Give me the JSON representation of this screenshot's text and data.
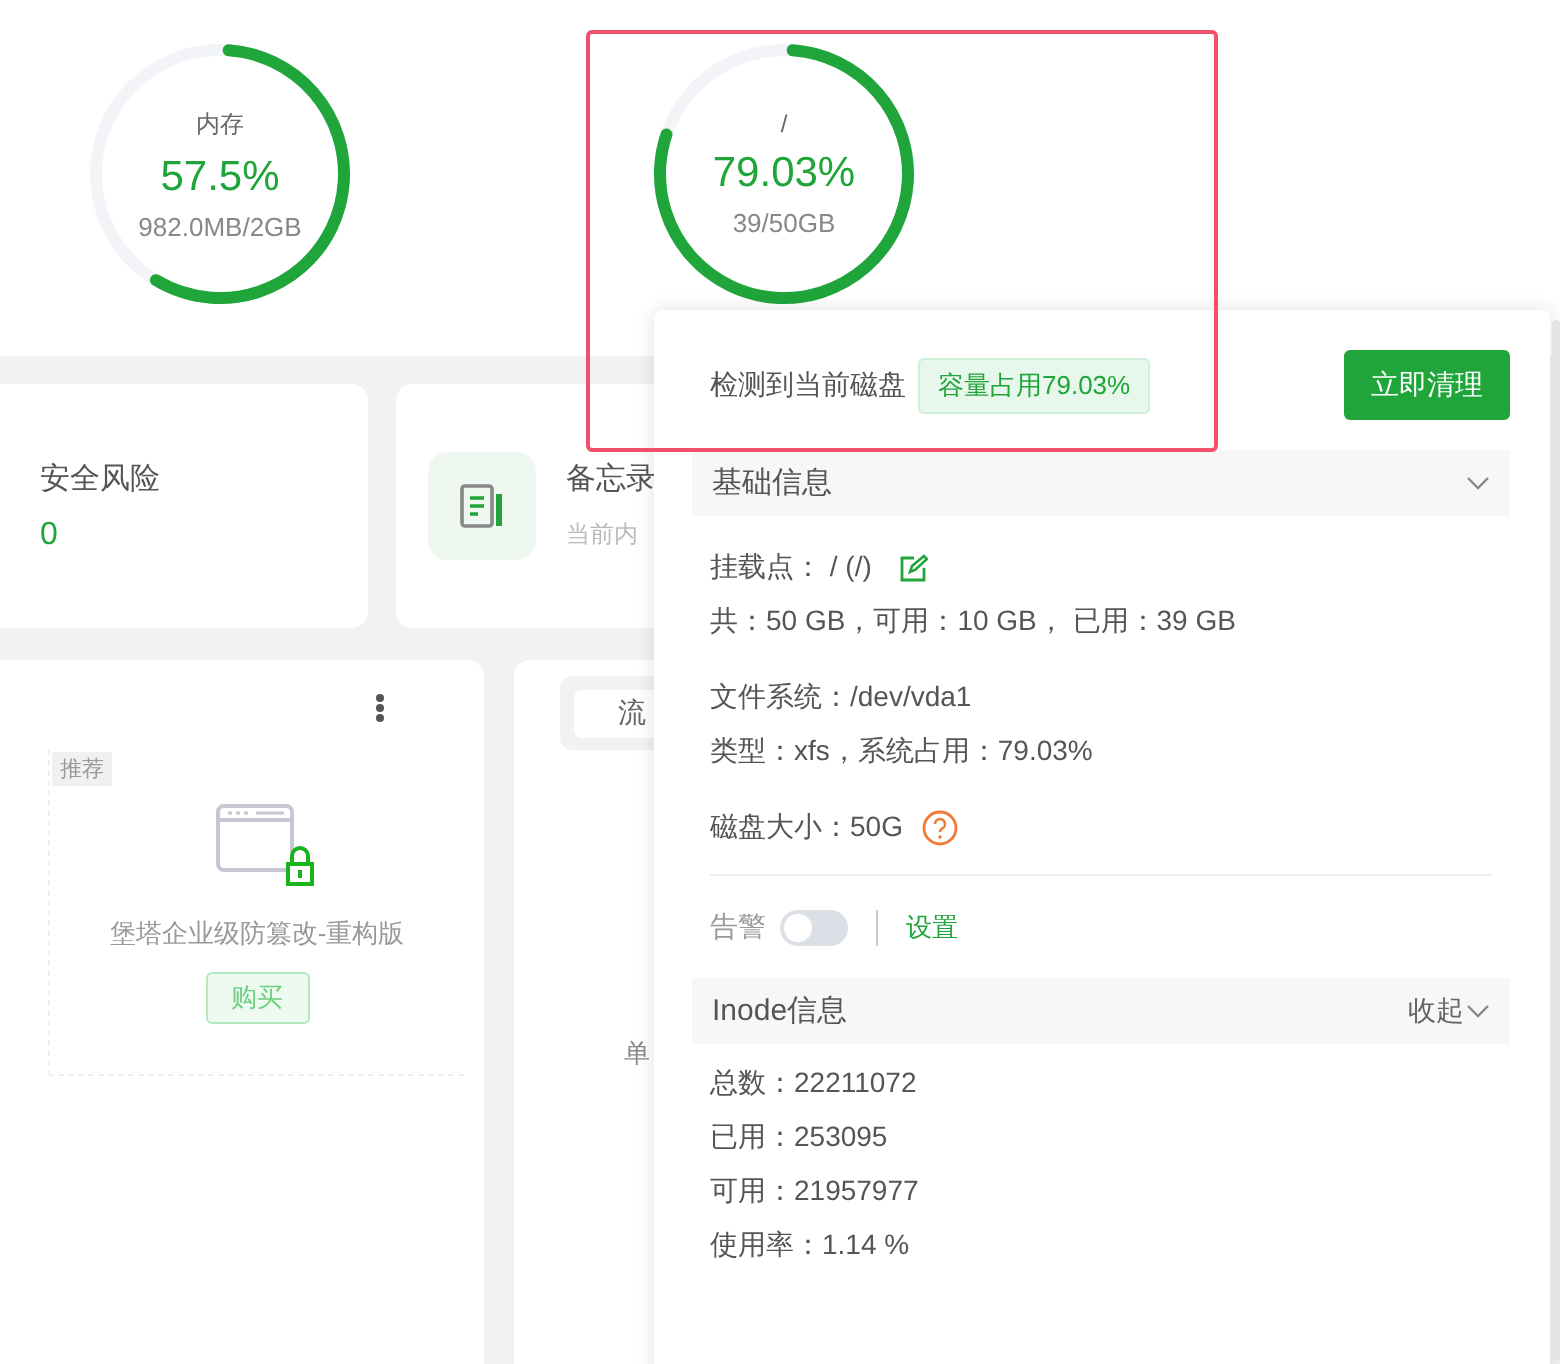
{
  "gauges": [
    {
      "label": "内存",
      "value": "57.5%",
      "detail": "982.0MB/2GB",
      "level": 0.575
    },
    {
      "label": "/",
      "value": "79.03%",
      "detail": "39/50GB",
      "level": 0.7903
    }
  ],
  "stat_cards": [
    {
      "kind": "value",
      "title": "安全风险",
      "value": "0"
    },
    {
      "kind": "note",
      "title": "备忘录",
      "subtitle": "当前内"
    }
  ],
  "plugin_card": {
    "tag": "推荐",
    "name": "堡塔企业级防篡改-重构版",
    "button": "购买"
  },
  "traffic_card": {
    "tab": "流",
    "axis_label": "单"
  },
  "disk_popover": {
    "message": "检测到当前磁盘",
    "usage_tag": "容量占用79.03%",
    "clean_button": "立即清理",
    "basic_section": {
      "title": "基础信息",
      "groups": [
        [
          {
            "kind": "editable",
            "text": "挂载点： / (/)"
          },
          {
            "kind": "plain",
            "text": "共：50 GB，可用：10 GB， 已用：39 GB"
          }
        ],
        [
          {
            "kind": "plain",
            "text": "文件系统：/dev/vda1"
          },
          {
            "kind": "plain",
            "text": "类型：xfs，系统占用：79.03%"
          }
        ],
        [
          {
            "kind": "help",
            "text": "磁盘大小：50G"
          }
        ]
      ]
    },
    "alert": {
      "label": "告警",
      "on": false,
      "link": "设置"
    },
    "inode_section": {
      "title": "Inode信息",
      "toggle": "收起",
      "lines": [
        "总数：22211072",
        "已用：253095",
        "可用：21957977",
        "使用率：1.14 %"
      ]
    }
  }
}
